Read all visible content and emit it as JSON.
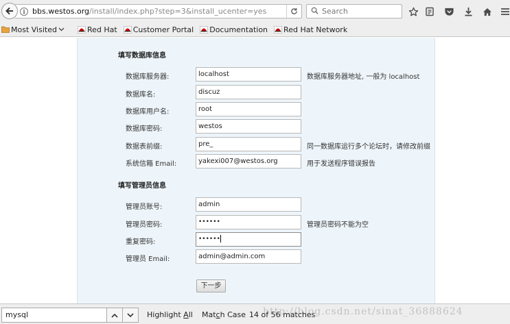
{
  "toolbar": {
    "url_host": "bbs.westos.org",
    "url_path": "/install/index.php?step=3&install_ucenter=yes",
    "search_placeholder": "Search"
  },
  "bookmarks": [
    {
      "label": "Most Visited",
      "icon": "folder-icon",
      "has_dropdown": true
    },
    {
      "label": "Red Hat",
      "icon": "redhat-icon"
    },
    {
      "label": "Customer Portal",
      "icon": "redhat-icon"
    },
    {
      "label": "Documentation",
      "icon": "redhat-icon"
    },
    {
      "label": "Red Hat Network",
      "icon": "redhat-icon"
    }
  ],
  "db_section": {
    "title": "填写数据库信息",
    "fields": [
      {
        "label": "数据库服务器:",
        "value": "localhost",
        "hint": "数据库服务器地址, 一般为 localhost"
      },
      {
        "label": "数据库名:",
        "value": "discuz",
        "hint": ""
      },
      {
        "label": "数据库用户名:",
        "value": "root",
        "hint": ""
      },
      {
        "label": "数据库密码:",
        "value": "westos",
        "hint": ""
      },
      {
        "label": "数据表前缀:",
        "value": "pre_",
        "hint": "同一数据库运行多个论坛时，请修改前缀"
      },
      {
        "label": "系统信箱 Email:",
        "value": "yakexi007@westos.org",
        "hint": "用于发送程序错误报告"
      }
    ]
  },
  "admin_section": {
    "title": "填写管理员信息",
    "fields": [
      {
        "label": "管理员账号:",
        "value": "admin",
        "hint": ""
      },
      {
        "label": "管理员密码:",
        "value": "••••••",
        "hint": "管理员密码不能为空"
      },
      {
        "label": "重复密码:",
        "value": "••••••",
        "hint": ""
      },
      {
        "label": "管理员 Email:",
        "value": "admin@admin.com",
        "hint": ""
      }
    ]
  },
  "next_button": "下一步",
  "findbar": {
    "query": "mysql",
    "highlight_prefix": "Highlight ",
    "highlight_key": "A",
    "highlight_suffix": "ll",
    "matchcase_prefix": "Mat",
    "matchcase_key": "c",
    "matchcase_suffix": "h Case",
    "match_status": "14 of 56 matches"
  },
  "watermark": "http://blog.csdn.net/sinat_36888624"
}
